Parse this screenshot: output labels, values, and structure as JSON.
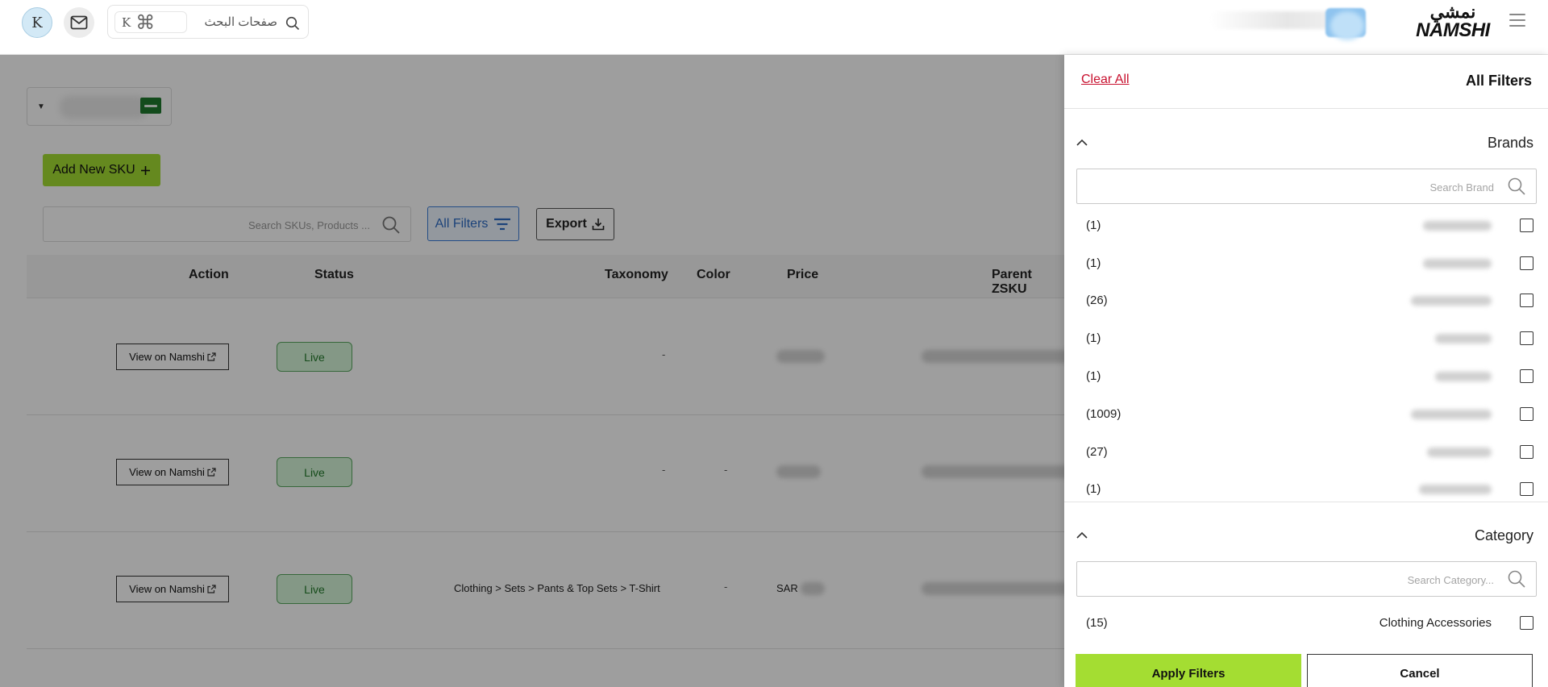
{
  "header": {
    "avatar_letter": "K",
    "search": {
      "shortcut_key": "K",
      "shortcut_cmd": "⌘",
      "placeholder": "صفحات البحث"
    },
    "logo": {
      "arabic": "نمشي",
      "english": "NAMSHI"
    }
  },
  "toolbar": {
    "add_sku_label": "Add New SKU",
    "search_placeholder": "Search SKUs, Products ...",
    "all_filters_label": "All Filters",
    "export_label": "Export"
  },
  "table": {
    "columns": {
      "action": "Action",
      "status": "Status",
      "taxonomy": "Taxonomy",
      "color": "Color",
      "price": "Price",
      "parent_zsku": "Parent ZSKU"
    },
    "rows": [
      {
        "action": "View on Namshi",
        "status": "Live",
        "taxonomy": "-",
        "color": "",
        "price_prefix": ""
      },
      {
        "action": "View on Namshi",
        "status": "Live",
        "taxonomy": "-",
        "color": "-",
        "price_prefix": ""
      },
      {
        "action": "View on Namshi",
        "status": "Live",
        "taxonomy": "Clothing > Sets > Pants & Top Sets > T-Shirt",
        "color": "-",
        "price_prefix": "SAR"
      }
    ]
  },
  "drawer": {
    "title": "All Filters",
    "clear_all": "Clear All",
    "brands": {
      "title": "Brands",
      "search_placeholder": "Search Brand",
      "items": [
        {
          "count": "(1)"
        },
        {
          "count": "(1)"
        },
        {
          "count": "(26)"
        },
        {
          "count": "(1)"
        },
        {
          "count": "(1)"
        },
        {
          "count": "(1009)"
        },
        {
          "count": "(27)"
        },
        {
          "count": "(1)"
        }
      ]
    },
    "category": {
      "title": "Category",
      "search_placeholder": "Search Category...",
      "items": [
        {
          "count": "(15)",
          "name": "Clothing Accessories"
        }
      ]
    },
    "apply_label": "Apply Filters",
    "cancel_label": "Cancel"
  },
  "colors": {
    "accent_green": "#a4dd32",
    "filter_blue": "#3b7dd8",
    "clear_red": "#c8102e",
    "live_green": "#59a95f"
  }
}
